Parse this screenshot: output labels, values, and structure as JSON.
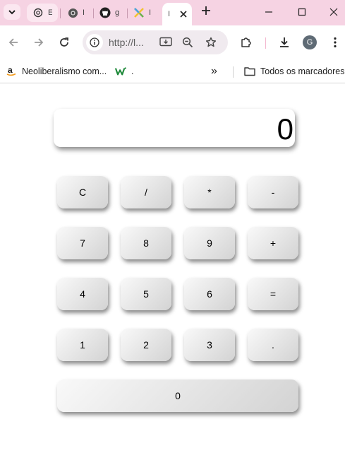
{
  "browser": {
    "tabs": [
      {
        "title": "E",
        "icon": "chatgpt-icon"
      },
      {
        "title": "I",
        "icon": "chrome-icon"
      },
      {
        "title": "g",
        "icon": "github-icon"
      },
      {
        "title": "I",
        "icon": "x-logo-icon"
      },
      {
        "title": "I",
        "icon": "page-icon",
        "active": true
      }
    ],
    "address": "http://l...",
    "profile_initial": "G",
    "accent_color": "#f6d3e3"
  },
  "bookmarks": {
    "items": [
      {
        "label": "Neoliberalismo com...",
        "icon": "amazon-icon"
      },
      {
        "label": ".",
        "icon": "w-logo-icon"
      }
    ],
    "overflow_label": "»",
    "all_bookmarks": "Todos os marcadores"
  },
  "calculator": {
    "display": "0",
    "rows": [
      [
        "C",
        "/",
        "*",
        "-"
      ],
      [
        "7",
        "8",
        "9",
        "+"
      ],
      [
        "4",
        "5",
        "6",
        "="
      ],
      [
        "1",
        "2",
        "3",
        "."
      ]
    ],
    "zero": "0"
  }
}
